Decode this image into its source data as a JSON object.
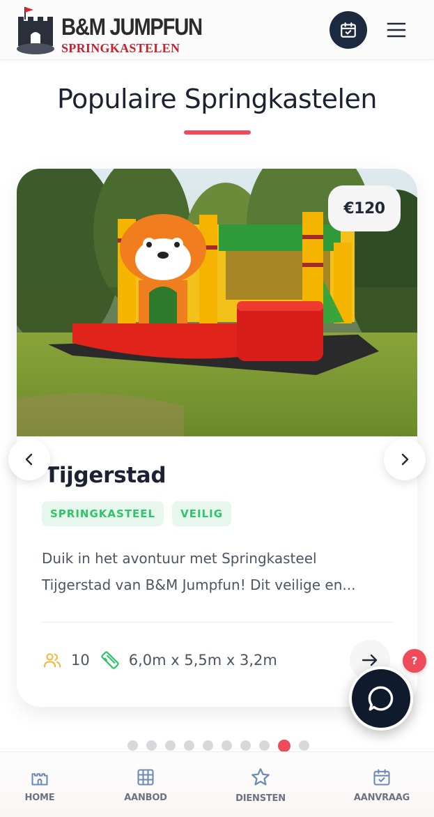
{
  "header": {
    "logo_title": "B&M JUMPFUN",
    "logo_subtitle": "SPRINGKASTELEN",
    "calendar_icon": "calendar-check-icon",
    "menu_icon": "hamburger-menu-icon"
  },
  "section": {
    "title": "Populaire Springkastelen",
    "accent_color": "#ef4b5a"
  },
  "card": {
    "price": "€120",
    "title": "Tijgerstad",
    "tags": [
      "SPRINGKASTEEL",
      "VEILIG"
    ],
    "description": "Duik in het avontuur met Springkasteel Tijgerstad van B&M Jumpfun! Dit veilige en...",
    "capacity": "10",
    "dimensions": "6,0m x 5,5m x 3,2m",
    "capacity_icon": "users-icon",
    "dimensions_icon": "ruler-icon",
    "image": "bouncy-castle-tiger-photo"
  },
  "carousel": {
    "prev_icon": "chevron-left-icon",
    "next_icon": "chevron-right-icon",
    "dot_count": 10,
    "active_index": 8
  },
  "widgets": {
    "help_label": "?",
    "chat_icon": "chat-bubble-icon"
  },
  "bottom_nav": {
    "items": [
      {
        "label": "HOME",
        "icon": "castle-icon"
      },
      {
        "label": "AANBOD",
        "icon": "grid-icon"
      },
      {
        "label": "DIENSTEN",
        "icon": "star-icon"
      },
      {
        "label": "AANVRAAG",
        "icon": "calendar-check-icon"
      }
    ]
  },
  "colors": {
    "navy": "#1c2a40",
    "red": "#ef4b5a",
    "green_tag": "#2ec46a",
    "yellow_icon": "#f4b63f"
  }
}
